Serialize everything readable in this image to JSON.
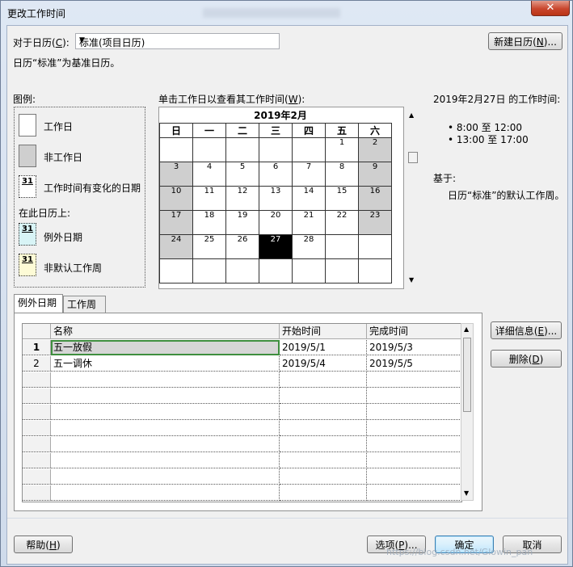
{
  "window": {
    "title": "更改工作时间",
    "close_glyph": "✕"
  },
  "calendar_select": {
    "label": "对于日历(",
    "hotkey": "C",
    "label_end": "):",
    "value": "标准(项目日历)"
  },
  "new_calendar_button": {
    "label": "新建日历(",
    "hotkey": "N",
    "label_end": ")..."
  },
  "base_calendar_note": "日历“标准”为基准日历。",
  "legend": {
    "heading": "图例:",
    "items": [
      "工作日",
      "非工作日",
      "工作时间有变化的日期"
    ],
    "on_calendar_heading": "在此日历上:",
    "calendar_items": [
      "例外日期",
      "非默认工作周"
    ],
    "swatch_number": "31"
  },
  "calendar": {
    "instruction": "单击工作日以查看其工作时间(",
    "instruction_hotkey": "W",
    "instruction_end": "):",
    "month_title": "2019年2月",
    "weekdays": [
      "日",
      "一",
      "二",
      "三",
      "四",
      "五",
      "六"
    ],
    "weeks": [
      [
        "",
        "",
        "",
        "",
        "",
        "1",
        "2"
      ],
      [
        "3",
        "4",
        "5",
        "6",
        "7",
        "8",
        "9"
      ],
      [
        "10",
        "11",
        "12",
        "13",
        "14",
        "15",
        "16"
      ],
      [
        "17",
        "18",
        "19",
        "20",
        "21",
        "22",
        "23"
      ],
      [
        "24",
        "25",
        "26",
        "27",
        "28",
        "",
        ""
      ],
      [
        "",
        "",
        "",
        "",
        "",
        "",
        ""
      ]
    ],
    "selected_day": "27"
  },
  "working_times": {
    "heading": "2019年2月27日 的工作时间:",
    "times": [
      "8:00 至 12:00",
      "13:00 至 17:00"
    ],
    "based_on_label": "基于:",
    "based_on_text": "日历“标准”的默认工作周。"
  },
  "tabs": [
    "例外日期",
    "工作周"
  ],
  "exceptions_table": {
    "columns": [
      "名称",
      "开始时间",
      "完成时间"
    ],
    "rows": [
      {
        "num": "1",
        "name": "五一放假",
        "start": "2019/5/1",
        "end": "2019/5/3"
      },
      {
        "num": "2",
        "name": "五一调休",
        "start": "2019/5/4",
        "end": "2019/5/5"
      }
    ]
  },
  "side_buttons": {
    "details": {
      "label": "详细信息(",
      "hotkey": "E",
      "label_end": ")..."
    },
    "delete": {
      "label": "删除(",
      "hotkey": "D",
      "label_end": ")"
    }
  },
  "footer": {
    "help": {
      "label": "帮助(",
      "hotkey": "H",
      "label_end": ")"
    },
    "options": {
      "label": "选项(",
      "hotkey": "P",
      "label_end": ")..."
    },
    "ok": "确定",
    "cancel": "取消"
  },
  "watermark": "https://blog.csdn.net/Glowin_pan",
  "colors": {
    "nonworking": "#cfcfcf",
    "selected": "#000000",
    "exception": "#d8f4f6",
    "nondefault_week": "#fdfbd6"
  }
}
